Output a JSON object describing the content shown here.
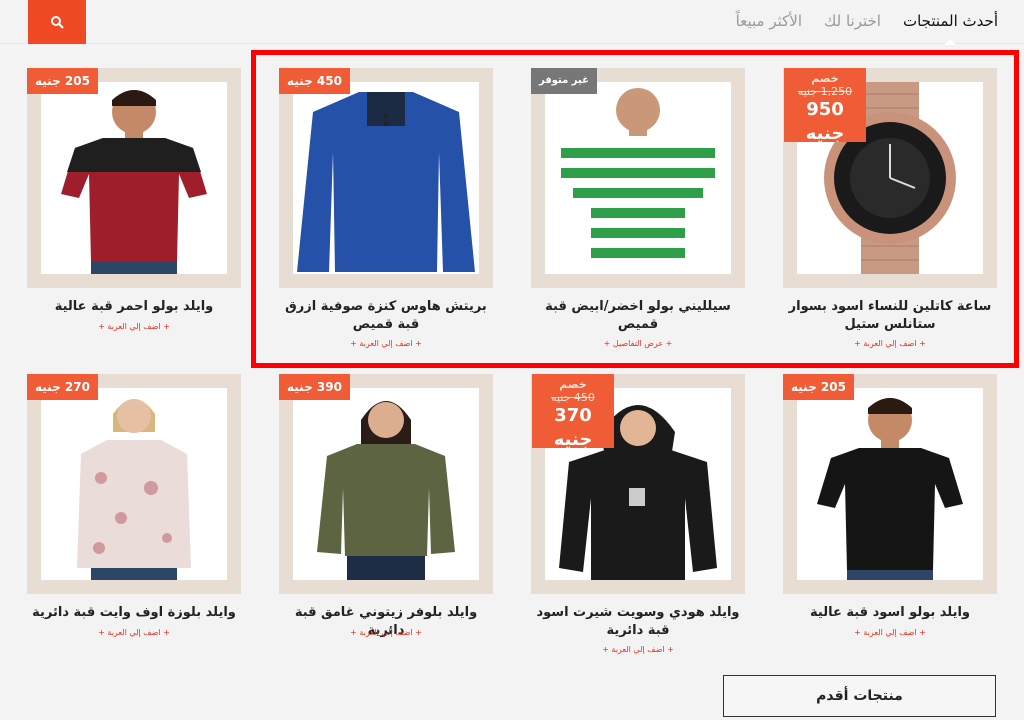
{
  "tabs": [
    {
      "label": "أحدث المنتجات",
      "active": true
    },
    {
      "label": "اخترنا لك",
      "active": false
    },
    {
      "label": "الأكثر مبيعاً",
      "active": false
    }
  ],
  "products": [
    {
      "title": "ساعة كاتلين للنساء اسود بسوار ستانلس ستيل",
      "link": "+ اضف إلي العربة +",
      "badge_type": "sale",
      "sale_label": "خصم",
      "old_price": "1,250 جنيه",
      "new_price": "950 جنيه"
    },
    {
      "title": "سيلليني بولو اخضر/ابيض قبة قميص",
      "link": "+ عرض التفاصيل +",
      "badge_type": "unavailable",
      "badge": "غير متوفر"
    },
    {
      "title": "بريتش هاوس كنزة صوفية ازرق قبة قميص",
      "link": "+ اضف إلي العربة +",
      "badge_type": "price",
      "badge": "450 جنيه"
    },
    {
      "title": "وايلد بولو احمر قبة عالية",
      "link": "+ اضف إلي العربة +",
      "badge_type": "price",
      "badge": "205 جنيه"
    },
    {
      "title": "وايلد بولو اسود قبة عالية",
      "link": "+ اضف إلي العربة +",
      "badge_type": "price",
      "badge": "205 جنيه"
    },
    {
      "title": "وايلد هودي وسويت شيرت اسود قبة دائرية",
      "link": "+ اضف إلي العربة +",
      "badge_type": "sale",
      "sale_label": "خصم",
      "old_price": "450 جنيه",
      "new_price": "370 جنيه"
    },
    {
      "title": "وايلد بلوفر زيتوني غامق قبة دائرية",
      "link": "+ اضف إلي العربة +",
      "badge_type": "price",
      "badge": "390 جنيه"
    },
    {
      "title": "وايلد بلوزة اوف وايت قبة دائرية",
      "link": "+ اضف إلي العربة +",
      "badge_type": "price",
      "badge": "270 جنيه"
    }
  ],
  "older_button": "منتجات أقدم",
  "colors": {
    "accent": "#ef4a23",
    "highlight": "#ff0000",
    "card_bg": "#e7ddd2"
  }
}
